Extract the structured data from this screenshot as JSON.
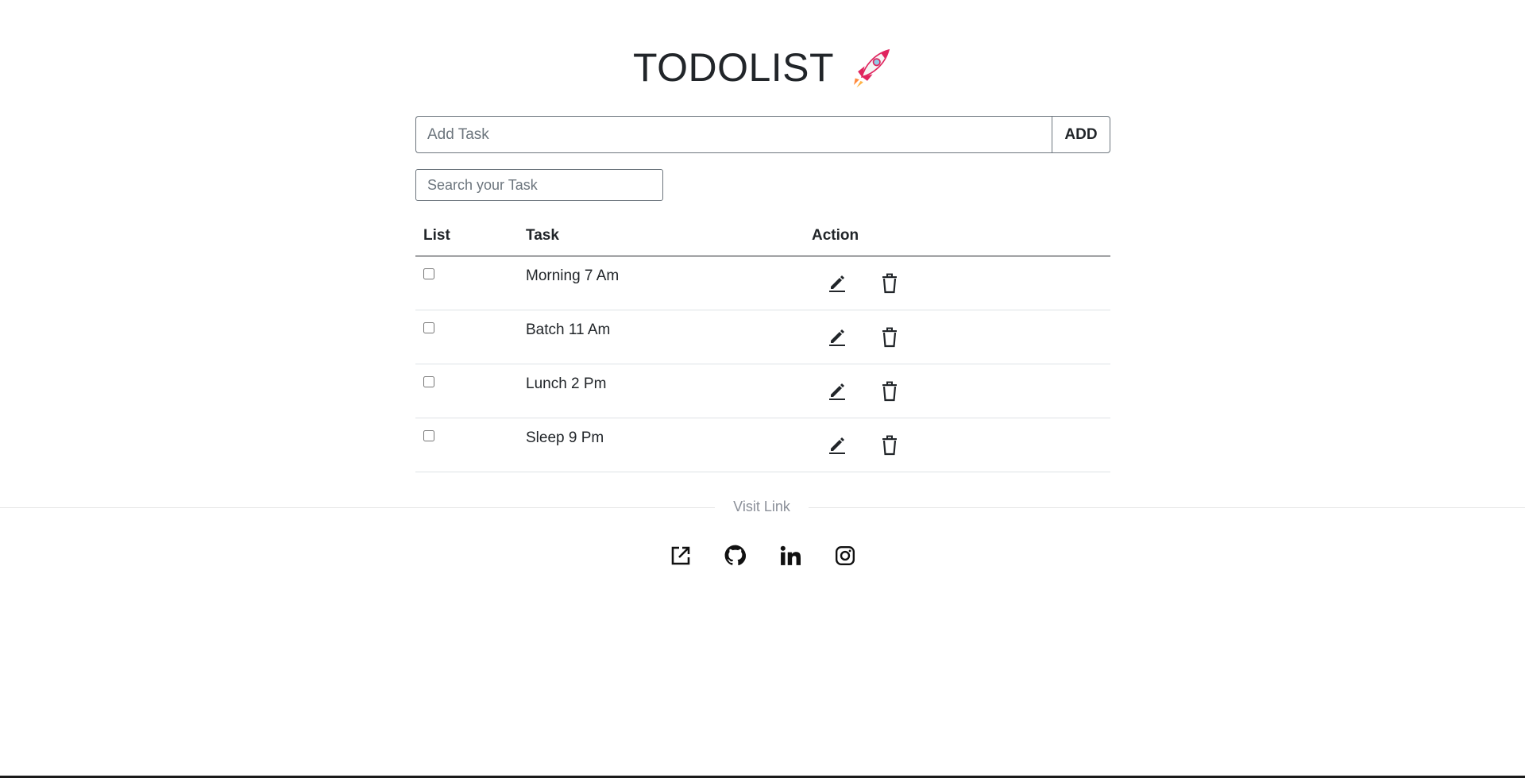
{
  "header": {
    "title": "TODOLIST"
  },
  "add_task": {
    "placeholder": "Add Task",
    "value": "",
    "button_label": "ADD"
  },
  "search": {
    "placeholder": "Search your Task",
    "value": ""
  },
  "table": {
    "columns": [
      "List",
      "Task",
      "Action"
    ],
    "rows": [
      {
        "checked": false,
        "task": "Morning 7 Am"
      },
      {
        "checked": false,
        "task": "Batch 11 Am"
      },
      {
        "checked": false,
        "task": "Lunch 2 Pm"
      },
      {
        "checked": false,
        "task": "Sleep 9 Pm"
      }
    ]
  },
  "footer": {
    "divider_label": "Visit Link",
    "links": [
      {
        "icon": "external-link-icon"
      },
      {
        "icon": "github-icon"
      },
      {
        "icon": "linkedin-icon"
      },
      {
        "icon": "instagram-icon"
      }
    ]
  },
  "colors": {
    "text": "#212529",
    "border": "#6c757d",
    "row_border": "#dee2e6",
    "rocket": "#e0245e"
  }
}
